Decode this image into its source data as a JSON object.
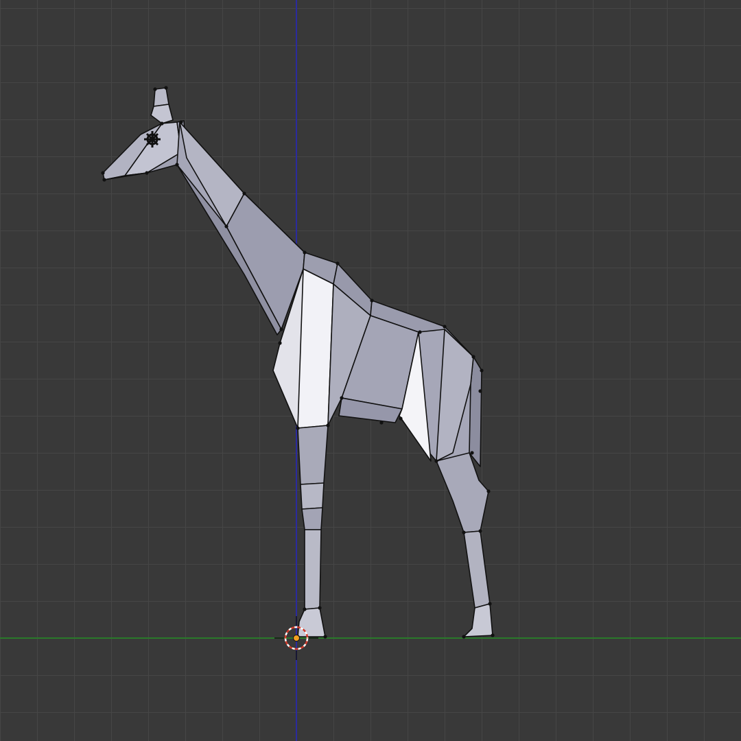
{
  "viewport": {
    "background_color": "#393939",
    "grid_color": "#464646",
    "x_axis_color": "#2a7a2a",
    "z_axis_color": "#2b2b9e",
    "mesh_edge_color": "#111111",
    "mesh_light_color": "#f2f2f7",
    "mesh_mid_color": "#a9aab8",
    "mesh_dark_color": "#8d8ea0",
    "cursor_ring_color": "#d23c2c",
    "object_origin_color": "#f0a020"
  },
  "scene": {
    "object": "giraffe-mesh",
    "view": "side-orthographic",
    "mode": "edit"
  }
}
